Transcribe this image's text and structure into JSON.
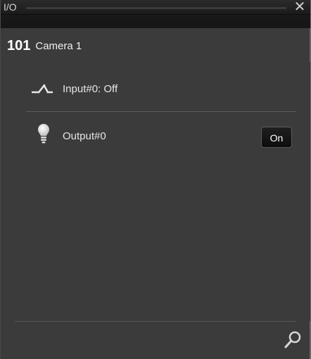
{
  "window": {
    "title": "I/O",
    "close_label": "✕"
  },
  "camera": {
    "number": "101",
    "name": "Camera 1"
  },
  "io": {
    "input": {
      "label": "Input#0: Off",
      "icon": "switch-icon"
    },
    "output": {
      "label": "Output#0",
      "icon": "lightbulb-icon",
      "button_label": "On"
    }
  },
  "footer": {
    "search_icon": "search-icon"
  },
  "colors": {
    "background": "#3b3b3b",
    "titlebar": "#1b1b1b",
    "text": "#e6e6e6",
    "button": "#141414"
  }
}
